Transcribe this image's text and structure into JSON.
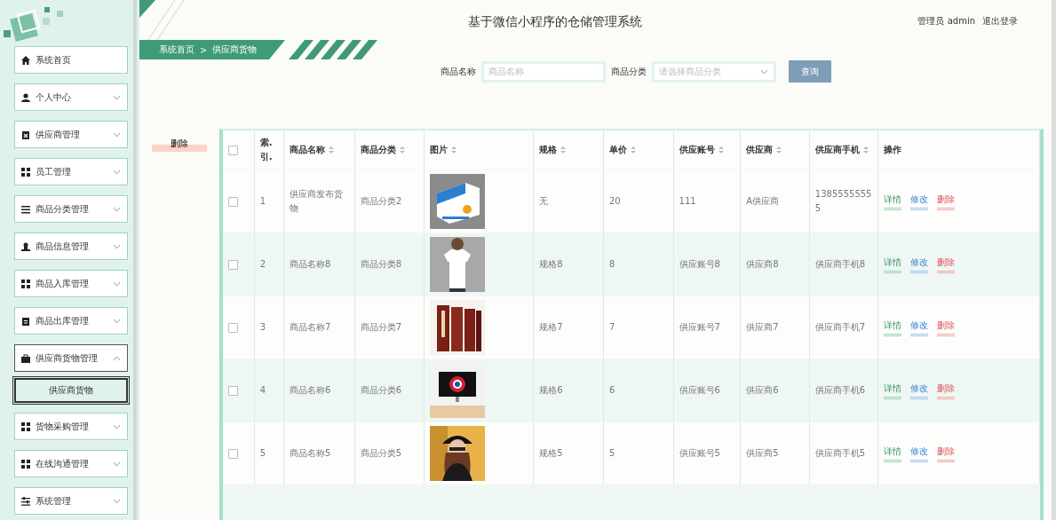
{
  "header": {
    "title": "基于微信小程序的仓储管理系统",
    "user_label": "管理员 admin",
    "logout": "退出登录"
  },
  "breadcrumb": {
    "items": [
      "系统首页",
      "供应商货物"
    ],
    "separator": ">"
  },
  "sidebar": {
    "items": [
      {
        "label": "系统首页"
      },
      {
        "label": "个人中心",
        "expanded": false
      },
      {
        "label": "供应商管理",
        "expanded": false
      },
      {
        "label": "员工管理",
        "expanded": false
      },
      {
        "label": "商品分类管理",
        "expanded": false
      },
      {
        "label": "商品信息管理",
        "expanded": false
      },
      {
        "label": "商品入库管理",
        "expanded": false
      },
      {
        "label": "商品出库管理",
        "expanded": false
      },
      {
        "label": "供应商货物管理",
        "expanded": true,
        "children": [
          {
            "label": "供应商货物",
            "selected": true
          }
        ]
      },
      {
        "label": "货物采购管理",
        "expanded": false
      },
      {
        "label": "在线沟通管理",
        "expanded": false
      },
      {
        "label": "系统管理",
        "expanded": false
      }
    ]
  },
  "search": {
    "fields": [
      {
        "label": "商品名称",
        "placeholder": "商品名称",
        "kind": "text"
      },
      {
        "label": "商品分类",
        "placeholder": "请选择商品分类",
        "kind": "select"
      }
    ],
    "button": "查询"
  },
  "delete_button": "删除",
  "table": {
    "select_all": {
      "checked": false
    },
    "columns": [
      {
        "label": "索.引.",
        "sortable": false
      },
      {
        "label": "商品名称",
        "sortable": true
      },
      {
        "label": "商品分类",
        "sortable": true
      },
      {
        "label": "图片",
        "sortable": true
      },
      {
        "label": "规格",
        "sortable": true
      },
      {
        "label": "单价",
        "sortable": true
      },
      {
        "label": "供应账号",
        "sortable": true
      },
      {
        "label": "供应商",
        "sortable": true
      },
      {
        "label": "供应商手机",
        "sortable": true
      },
      {
        "label": "操作",
        "sortable": false
      }
    ],
    "rows": [
      {
        "checked": false,
        "cells": [
          "1",
          "供应商发布货物",
          "商品分类2",
          "",
          "无",
          "20",
          "111",
          "A供应商",
          "13855555555"
        ],
        "actions": [
          {
            "label": "详情",
            "kind": "detail"
          },
          {
            "label": "修改",
            "kind": "edit"
          },
          {
            "label": "删除",
            "kind": "delete"
          }
        ]
      },
      {
        "checked": false,
        "cells": [
          "2",
          "商品名称8",
          "商品分类8",
          "",
          "规格8",
          "8",
          "供应账号8",
          "供应商8",
          "供应商手机8"
        ],
        "actions": [
          {
            "label": "详情",
            "kind": "detail"
          },
          {
            "label": "修改",
            "kind": "edit"
          },
          {
            "label": "删除",
            "kind": "delete"
          }
        ]
      },
      {
        "checked": false,
        "cells": [
          "3",
          "商品名称7",
          "商品分类7",
          "",
          "规格7",
          "7",
          "供应账号7",
          "供应商7",
          "供应商手机7"
        ],
        "actions": [
          {
            "label": "详情",
            "kind": "detail"
          },
          {
            "label": "修改",
            "kind": "edit"
          },
          {
            "label": "删除",
            "kind": "delete"
          }
        ]
      },
      {
        "checked": false,
        "cells": [
          "4",
          "商品名称6",
          "商品分类6",
          "",
          "规格6",
          "6",
          "供应账号6",
          "供应商6",
          "供应商手机6"
        ],
        "actions": [
          {
            "label": "详情",
            "kind": "detail"
          },
          {
            "label": "修改",
            "kind": "edit"
          },
          {
            "label": "删除",
            "kind": "delete"
          }
        ]
      },
      {
        "checked": false,
        "cells": [
          "5",
          "商品名称5",
          "商品分类5",
          "",
          "规格5",
          "5",
          "供应账号5",
          "供应商5",
          "供应商手机5"
        ],
        "actions": [
          {
            "label": "详情",
            "kind": "detail"
          },
          {
            "label": "修改",
            "kind": "edit"
          },
          {
            "label": "删除",
            "kind": "delete"
          }
        ]
      }
    ]
  }
}
